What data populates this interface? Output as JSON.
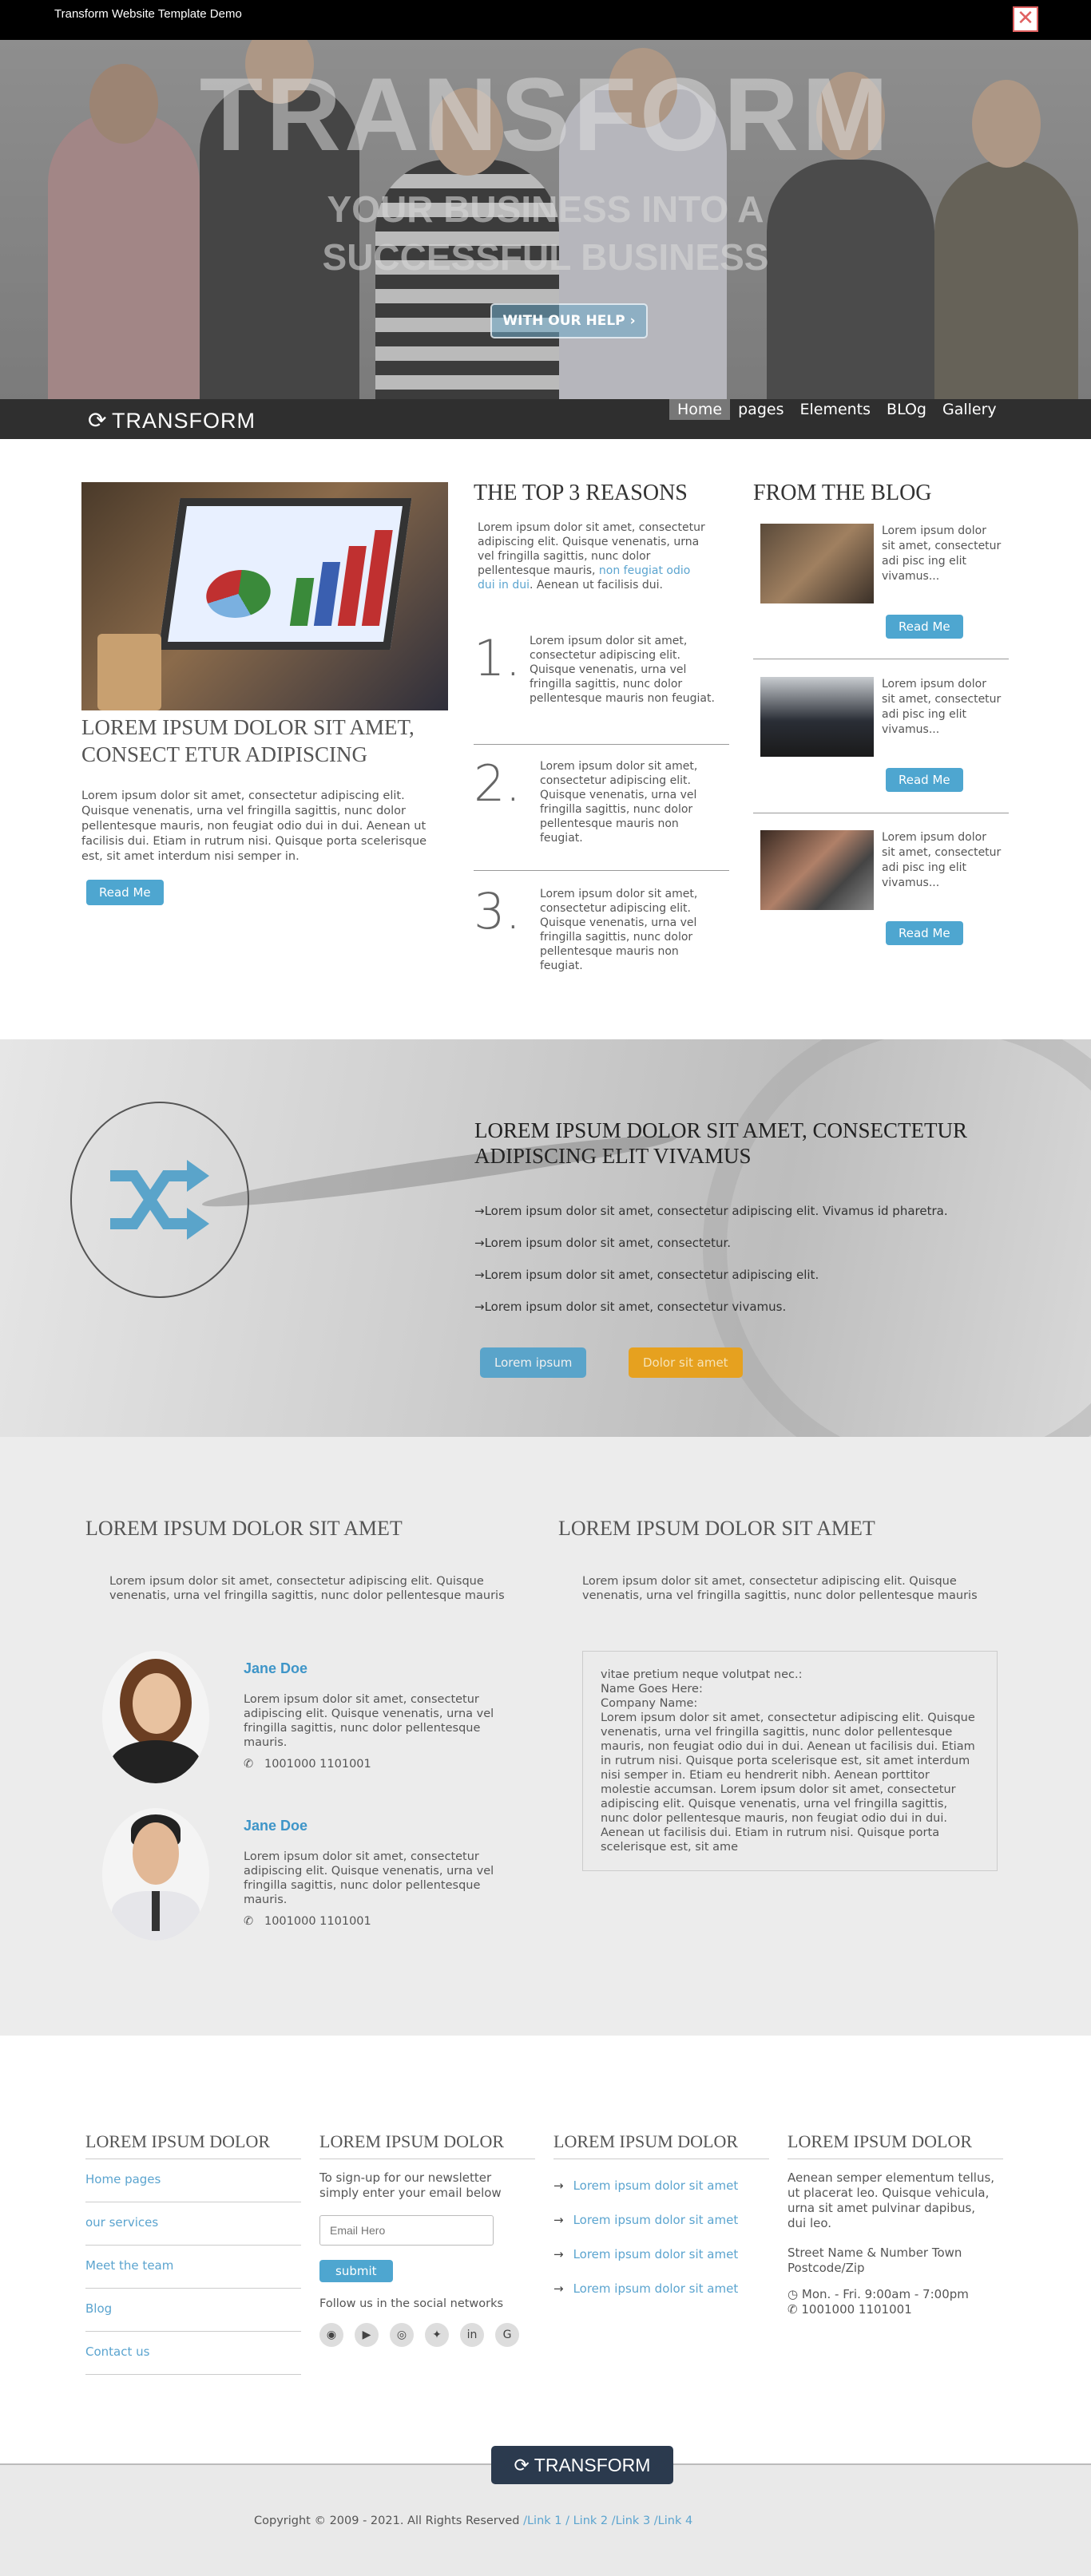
{
  "demo_bar": {
    "title": "Transform Website Template Demo"
  },
  "hero": {
    "headline": "TRANSFORM",
    "subline1": "YOUR BUSINESS INTO A",
    "subline2": "SUCCESSFUL BUSINESS",
    "cta": "WITH OUR HELP"
  },
  "nav": {
    "logo": "TRANSFORM",
    "items": [
      "Home",
      "pages",
      "Elements",
      "BLOg",
      "Gallery"
    ],
    "active": "Home"
  },
  "feature": {
    "title": "LOREM IPSUM DOLOR SIT AMET, CONSECT ETUR ADIPISCING",
    "body": "Lorem ipsum dolor sit amet, consectetur adipiscing elit. Quisque venenatis, urna vel fringilla sagittis, nunc dolor pellentesque mauris, non feugiat odio dui in dui. Aenean ut facilisis dui. Etiam in rutrum nisi. Quisque porta scelerisque est, sit amet interdum nisi semper in.",
    "button": "Read Me"
  },
  "reasons": {
    "title": "THE TOP 3 REASONS",
    "intro_start": "Lorem ipsum dolor sit amet, consectetur adipiscing elit. Quisque venenatis, urna vel fringilla sagittis, nunc dolor pellentesque mauris, ",
    "intro_link": "non feugiat odio dui in dui",
    "intro_end": ". Aenean ut facilisis dui.",
    "items": [
      {
        "num": "1.",
        "text": "Lorem ipsum dolor sit amet, consectetur adipiscing elit. Quisque venenatis, urna vel fringilla sagittis, nunc dolor pellentesque mauris non feugiat."
      },
      {
        "num": "2.",
        "text": "Lorem ipsum dolor sit amet, consectetur adipiscing elit. Quisque venenatis, urna vel fringilla sagittis, nunc dolor pellentesque mauris non feugiat."
      },
      {
        "num": "3.",
        "text": "Lorem ipsum dolor sit amet, consectetur adipiscing elit. Quisque venenatis, urna vel fringilla sagittis, nunc dolor pellentesque mauris non feugiat."
      }
    ]
  },
  "blog": {
    "title": "FROM THE BLOG",
    "posts": [
      {
        "text": "Lorem ipsum dolor sit amet, consectetur adi pisc ing elit vivamus...",
        "button": "Read Me"
      },
      {
        "text": "Lorem ipsum dolor sit amet, consectetur adi pisc ing elit vivamus...",
        "button": "Read Me"
      },
      {
        "text": "Lorem ipsum dolor sit amet, consectetur adi pisc ing elit vivamus...",
        "button": "Read Me"
      }
    ]
  },
  "banner": {
    "title": "LOREM IPSUM DOLOR SIT AMET, CONSECTETUR ADIPISCING ELIT VIVAMUS",
    "bullets": [
      "Lorem ipsum dolor sit amet, consectetur adipiscing elit. Vivamus id pharetra.",
      "Lorem ipsum dolor sit amet, consectetur.",
      "Lorem ipsum dolor sit amet, consectetur adipiscing elit.",
      "Lorem ipsum dolor sit amet, consectetur vivamus."
    ],
    "button1": "Lorem ipsum",
    "button2": "Dolor sit amet",
    "accent": "#5aa4ca",
    "accent2": "#e6a11f"
  },
  "team": {
    "title": "LOREM IPSUM DOLOR SIT AMET",
    "intro": "Lorem ipsum dolor sit amet, consectetur adipiscing elit. Quisque venenatis, urna vel fringilla sagittis, nunc dolor pellentesque mauris",
    "members": [
      {
        "name": "Jane Doe",
        "text": "Lorem ipsum dolor sit amet, consectetur adipiscing elit. Quisque venenatis, urna vel fringilla sagittis, nunc dolor pellentesque mauris.",
        "phone": "1001000 1101001"
      },
      {
        "name": "Jane Doe",
        "text": "Lorem ipsum dolor sit amet, consectetur adipiscing elit. Quisque venenatis, urna vel fringilla sagittis, nunc dolor pellentesque mauris.",
        "phone": "1001000 1101001"
      }
    ]
  },
  "testimonial": {
    "title": "LOREM IPSUM DOLOR SIT AMET",
    "intro": "Lorem ipsum dolor sit amet, consectetur adipiscing elit. Quisque venenatis, urna vel fringilla sagittis, nunc dolor pellentesque mauris",
    "line1": "vitae pretium neque volutpat nec.:",
    "line2": "Name Goes Here:",
    "line3": "Company Name:",
    "body": "Lorem ipsum dolor sit amet, consectetur adipiscing elit. Quisque venenatis, urna vel fringilla sagittis, nunc dolor pellentesque mauris, non feugiat odio dui in dui. Aenean ut facilisis dui. Etiam in rutrum nisi. Quisque porta scelerisque est, sit amet interdum nisi semper in. Etiam eu hendrerit nibh. Aenean porttitor molestie accumsan. Lorem ipsum dolor sit amet, consectetur adipiscing elit. Quisque venenatis, urna vel fringilla sagittis, nunc dolor pellentesque mauris, non feugiat odio dui in dui. Aenean ut facilisis dui. Etiam in rutrum nisi. Quisque porta scelerisque est, sit ame"
  },
  "footer": {
    "col1": {
      "title": "LOREM IPSUM DOLOR",
      "links": [
        "Home pages",
        "our services",
        "Meet the team",
        "Blog",
        "Contact us"
      ]
    },
    "col2": {
      "title": "LOREM IPSUM DOLOR",
      "text": "To sign-up for our newsletter simply enter your email below",
      "placeholder": "Email Hero",
      "button": "submit",
      "social_text": "Follow us in the social networks",
      "social_icons": [
        "github-icon",
        "youtube-icon",
        "instagram-icon",
        "twitter-icon",
        "linkedin-icon",
        "google-icon"
      ]
    },
    "col3": {
      "title": "LOREM IPSUM DOLOR",
      "links": [
        "Lorem ipsum dolor sit amet",
        "Lorem ipsum dolor sit amet",
        "Lorem ipsum dolor sit amet",
        "Lorem ipsum dolor sit amet"
      ]
    },
    "col4": {
      "title": "LOREM IPSUM DOLOR",
      "text": "Aenean semper elementum tellus, ut placerat leo. Quisque vehicula, urna sit amet pulvinar dapibus, dui leo.",
      "address1": "Street Name & Number Town",
      "address2": "Postcode/Zip",
      "hours": "Mon. - Fri. 9:00am - 7:00pm",
      "phone": "1001000 1101001"
    }
  },
  "bottom": {
    "logo": "TRANSFORM",
    "copyright": "Copyright © 2009 - 2021. All Rights Reserved",
    "links": [
      "/Link 1",
      "/ Link 2",
      "/Link 3",
      "/Link 4"
    ]
  }
}
